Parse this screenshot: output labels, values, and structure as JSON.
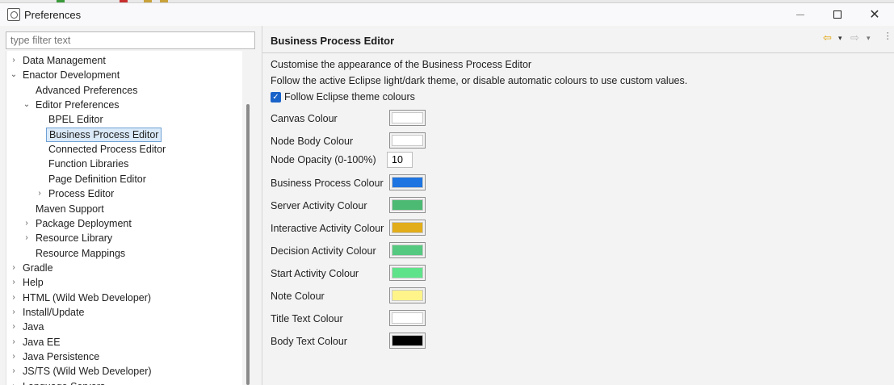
{
  "window": {
    "title": "Preferences",
    "minimize": "—",
    "close": "✕"
  },
  "filter": {
    "placeholder": "type filter text"
  },
  "tree": [
    {
      "label": "Data Management",
      "level": 0,
      "twisty": "›"
    },
    {
      "label": "Enactor Development",
      "level": 0,
      "twisty": "⌄"
    },
    {
      "label": "Advanced Preferences",
      "level": 1,
      "twisty": ""
    },
    {
      "label": "Editor Preferences",
      "level": 1,
      "twisty": "⌄"
    },
    {
      "label": "BPEL Editor",
      "level": 2,
      "twisty": ""
    },
    {
      "label": "Business Process Editor",
      "level": 2,
      "twisty": "",
      "selected": true
    },
    {
      "label": "Connected Process Editor",
      "level": 2,
      "twisty": ""
    },
    {
      "label": "Function Libraries",
      "level": 2,
      "twisty": ""
    },
    {
      "label": "Page Definition Editor",
      "level": 2,
      "twisty": ""
    },
    {
      "label": "Process Editor",
      "level": 2,
      "twisty": "›"
    },
    {
      "label": "Maven Support",
      "level": 1,
      "twisty": ""
    },
    {
      "label": "Package Deployment",
      "level": 1,
      "twisty": "›"
    },
    {
      "label": "Resource Library",
      "level": 1,
      "twisty": "›"
    },
    {
      "label": "Resource Mappings",
      "level": 1,
      "twisty": ""
    },
    {
      "label": "Gradle",
      "level": 0,
      "twisty": "›"
    },
    {
      "label": "Help",
      "level": 0,
      "twisty": "›"
    },
    {
      "label": "HTML (Wild Web Developer)",
      "level": 0,
      "twisty": "›"
    },
    {
      "label": "Install/Update",
      "level": 0,
      "twisty": "›"
    },
    {
      "label": "Java",
      "level": 0,
      "twisty": "›"
    },
    {
      "label": "Java EE",
      "level": 0,
      "twisty": "›"
    },
    {
      "label": "Java Persistence",
      "level": 0,
      "twisty": "›"
    },
    {
      "label": "JS/TS (Wild Web Developer)",
      "level": 0,
      "twisty": "›"
    },
    {
      "label": "Language Servers",
      "level": 0,
      "twisty": "›"
    }
  ],
  "page": {
    "title": "Business Process Editor",
    "nav": {
      "back": "⇦",
      "forward": "⇨",
      "dropdown": "▾",
      "more": "⋯"
    },
    "description": "Customise the appearance of the Business Process Editor",
    "description2": "Follow the active Eclipse light/dark theme, or disable automatic colours to use custom values.",
    "follow_theme": {
      "label": "Follow Eclipse theme colours",
      "checked": true,
      "mark": "✓"
    },
    "opacity": {
      "label": "Node Opacity (0-100%)",
      "value": "10"
    },
    "colours": [
      {
        "label": "Canvas Colour",
        "color": "#ffffff"
      },
      {
        "label": "Node Body Colour",
        "color": "#ffffff"
      },
      {
        "label": "Business Process Colour",
        "color": "#1e74e0"
      },
      {
        "label": "Server Activity Colour",
        "color": "#4dba73"
      },
      {
        "label": "Interactive Activity Colour",
        "color": "#e2ad1a"
      },
      {
        "label": "Decision Activity Colour",
        "color": "#55c97f"
      },
      {
        "label": "Start Activity Colour",
        "color": "#5fe38a"
      },
      {
        "label": "Note Colour",
        "color": "#fff48a"
      },
      {
        "label": "Title Text Colour",
        "color": "#ffffff"
      },
      {
        "label": "Body Text Colour",
        "color": "#000000"
      }
    ]
  }
}
